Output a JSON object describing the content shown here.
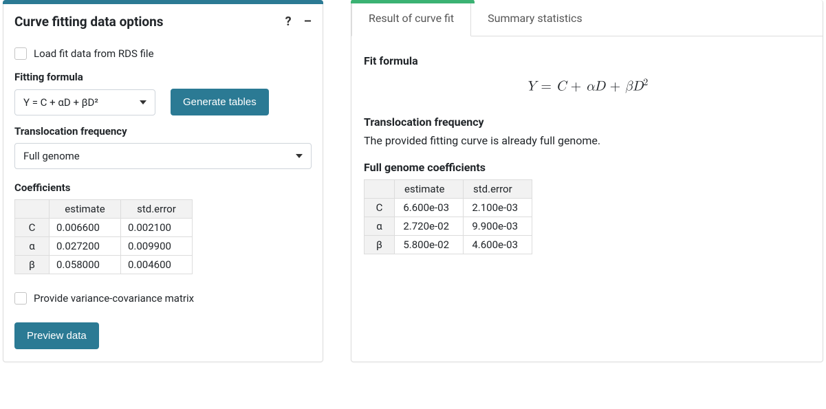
{
  "left": {
    "title": "Curve fitting data options",
    "help_icon": "?",
    "collapse_icon": "–",
    "load_rds_label": "Load fit data from RDS file",
    "formula_label": "Fitting formula",
    "formula_value": "Y = C + αD + βD²",
    "generate_btn": "Generate tables",
    "trans_label": "Translocation frequency",
    "trans_value": "Full genome",
    "coeff_label": "Coefficients",
    "headers": [
      "estimate",
      "std.error"
    ],
    "rows": [
      {
        "name": "C",
        "estimate": "0.006600",
        "stderr": "0.002100"
      },
      {
        "name": "α",
        "estimate": "0.027200",
        "stderr": "0.009900"
      },
      {
        "name": "β",
        "estimate": "0.058000",
        "stderr": "0.004600"
      }
    ],
    "varcov_label": "Provide variance-covariance matrix",
    "preview_btn": "Preview data"
  },
  "right": {
    "tabs": [
      "Result of curve fit",
      "Summary statistics"
    ],
    "fit_formula_label": "Fit formula",
    "trans_label": "Translocation frequency",
    "trans_text": "The provided fitting curve is already full genome.",
    "coeff_label": "Full genome coefficients",
    "headers": [
      "estimate",
      "std.error"
    ],
    "rows": [
      {
        "name": "C",
        "estimate": "6.600e-03",
        "stderr": "2.100e-03"
      },
      {
        "name": "α",
        "estimate": "2.720e-02",
        "stderr": "9.900e-03"
      },
      {
        "name": "β",
        "estimate": "5.800e-02",
        "stderr": "4.600e-03"
      }
    ]
  }
}
